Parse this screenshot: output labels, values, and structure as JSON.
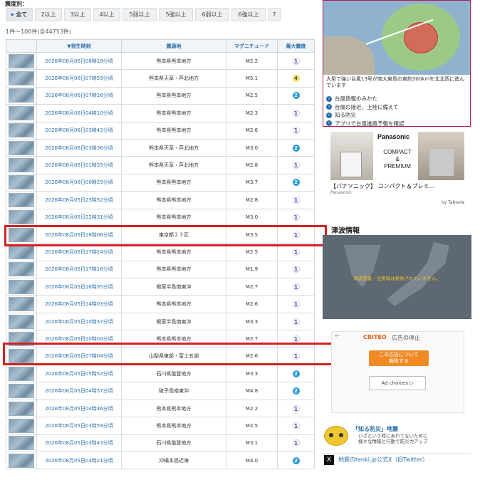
{
  "filter": {
    "label": "震度別：",
    "buttons": [
      "全て",
      "2以上",
      "3以上",
      "4以上",
      "5弱以上",
      "5強以上",
      "6弱以上",
      "6強以上",
      "7"
    ]
  },
  "count_text": "1件～100件(全44753件)",
  "table": {
    "headers": {
      "thumb": "",
      "time": "発生時刻",
      "place": "震源地",
      "magnitude": "マグニチュード",
      "intensity": "最大震度"
    },
    "rows": [
      {
        "time": "2026年08月06日08時19分頃",
        "place": "熊本県熊本地方",
        "mag": "M2.2",
        "intensity": "1"
      },
      {
        "time": "2026年08月06日07時59分頃",
        "place": "熊本県天草・芦北地方",
        "mag": "M5.1",
        "intensity": "4"
      },
      {
        "time": "2026年08月06日07時26分頃",
        "place": "熊本県熊本地方",
        "mag": "M2.5",
        "intensity": "2"
      },
      {
        "time": "2026年08月06日04時10分頃",
        "place": "熊本県熊本地方",
        "mag": "M2.3",
        "intensity": "1"
      },
      {
        "time": "2026年08月06日03時43分頃",
        "place": "熊本県熊本地方",
        "mag": "M2.6",
        "intensity": "1"
      },
      {
        "time": "2026年08月06日03時36分頃",
        "place": "熊本県天草・芦北地方",
        "mag": "M3.0",
        "intensity": "2"
      },
      {
        "time": "2026年08月06日01時35分頃",
        "place": "熊本県天草・芦北地方",
        "mag": "M2.8",
        "intensity": "1"
      },
      {
        "time": "2026年08月06日00時29分頃",
        "place": "熊本県熊本地方",
        "mag": "M3.7",
        "intensity": "2"
      },
      {
        "time": "2026年08月05日23時52分頃",
        "place": "熊本県熊本地方",
        "mag": "M2.8",
        "intensity": "1"
      },
      {
        "time": "2026年08月05日22時31分頃",
        "place": "熊本県熊本地方",
        "mag": "M3.0",
        "intensity": "1"
      },
      {
        "time": "2026年08月05日18時06分頃",
        "place": "東京都２３区",
        "mag": "M3.5",
        "intensity": "1"
      },
      {
        "time": "2026年08月05日17時24分頃",
        "place": "熊本県熊本地方",
        "mag": "M2.5",
        "intensity": "1"
      },
      {
        "time": "2026年08月05日17時16分頃",
        "place": "熊本県熊本地方",
        "mag": "M1.9",
        "intensity": "1"
      },
      {
        "time": "2026年08月05日16時35分頃",
        "place": "根室半島南東沖",
        "mag": "M2.7",
        "intensity": "1"
      },
      {
        "time": "2026年08月05日14時03分頃",
        "place": "熊本県熊本地方",
        "mag": "M2.6",
        "intensity": "1"
      },
      {
        "time": "2026年08月05日10時37分頃",
        "place": "根室半島南東沖",
        "mag": "M3.3",
        "intensity": "1"
      },
      {
        "time": "2026年08月05日10時04分頃",
        "place": "熊本県熊本地方",
        "mag": "M2.7",
        "intensity": "1"
      },
      {
        "time": "2026年08月05日07時04分頃",
        "place": "山梨県東部・富士五湖",
        "mag": "M2.6",
        "intensity": "1"
      },
      {
        "time": "2026年08月05日05時52分頃",
        "place": "石川県能登地方",
        "mag": "M3.3",
        "intensity": "2"
      },
      {
        "time": "2026年08月05日04時57分頃",
        "place": "硫子島南東沖",
        "mag": "M4.8",
        "intensity": "2"
      },
      {
        "time": "2026年08月05日04時46分頃",
        "place": "熊本県熊本地方",
        "mag": "M2.2",
        "intensity": "1"
      },
      {
        "time": "2026年08月05日03時59分頃",
        "place": "熊本県熊本地方",
        "mag": "M2.5",
        "intensity": "1"
      },
      {
        "time": "2026年08月05日03時43分頃",
        "place": "石川県能登地方",
        "mag": "M3.1",
        "intensity": "1"
      },
      {
        "time": "2026年08月05日03時21分頃",
        "place": "沖縄本島近海",
        "mag": "M4.0",
        "intensity": "2"
      }
    ]
  },
  "typhoon": {
    "caption": "大型で強い台風13号が南大東島の東約300kmを北北西に進んでいます",
    "links": [
      "台風情報のみかた",
      "台風の接近、上陸に備えて",
      "知る防災",
      "アプリで台風進路予報を確認"
    ]
  },
  "ad_panasonic": {
    "brand": "Panasonic",
    "compact": "COMPACT",
    "amp": "&",
    "premium": "PREMIUM",
    "title": "【パナソニック】 コンパクト＆プレミ…",
    "source": "Panasonic",
    "taboola": "by Taboola"
  },
  "tsunami": {
    "title": "津波情報",
    "message": "津波警報・注意報は発表されていません。"
  },
  "ad_criteo": {
    "back": "←",
    "brand": "CRITEO",
    "stop": "広告の停止",
    "about_line1": "この広告について",
    "about_line2": "報告する",
    "choices": "Ad choices ▷"
  },
  "bousai": {
    "title": "「知る防災」地震",
    "line1": "いざという時にあわてないために",
    "line2": "様々な情報と行動で防災力アップ"
  },
  "x_link": {
    "icon": "X",
    "text": "地震のtenki.jp公式X（旧Twitter）"
  },
  "colors": {
    "highlight": "#d42020",
    "link": "#2a6fa8",
    "intensity2": "#2b9bd6",
    "intensity4": "#f2e25c"
  }
}
